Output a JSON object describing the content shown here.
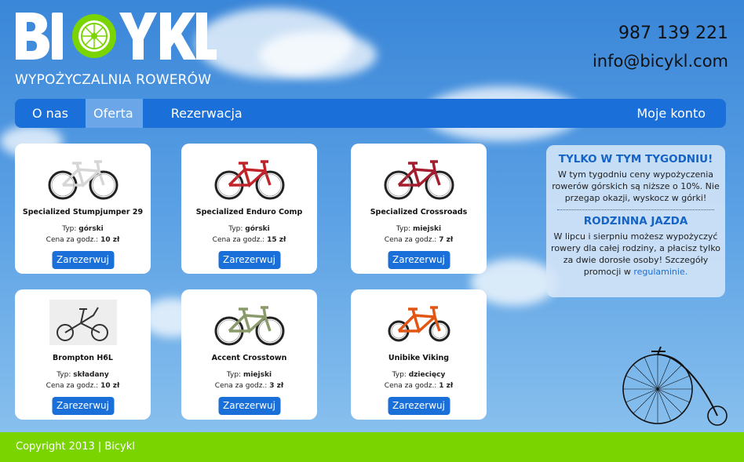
{
  "brand": {
    "name": "BICYKL",
    "tagline": "WYPOŻYCZALNIA ROWERÓW"
  },
  "contact": {
    "phone": "987 139 221",
    "email": "info@bicykl.com"
  },
  "nav": {
    "items": [
      {
        "label": "O nas"
      },
      {
        "label": "Oferta"
      },
      {
        "label": "Rezerwacja"
      }
    ],
    "account": "Moje konto"
  },
  "labels": {
    "type": "Typ:",
    "price": "Cena za godz.:",
    "reserve": "Zarezerwuj"
  },
  "bikes": [
    {
      "name": "Specialized Stumpjumper 29",
      "type": "górski",
      "price": "10 zł",
      "color": "#d6d6d6"
    },
    {
      "name": "Specialized Enduro Comp",
      "type": "górski",
      "price": "15 zł",
      "color": "#c0232a"
    },
    {
      "name": "Specialized Crossroads",
      "type": "miejski",
      "price": "7 zł",
      "color": "#a41d2e"
    },
    {
      "name": "Brompton H6L",
      "type": "składany",
      "price": "10 zł",
      "color": "#333333"
    },
    {
      "name": "Accent Crosstown",
      "type": "miejski",
      "price": "3 zł",
      "color": "#8a9a6a"
    },
    {
      "name": "Unibike Viking",
      "type": "dziecięcy",
      "price": "1 zł",
      "color": "#e25512"
    }
  ],
  "promo": {
    "title1": "TYLKO W TYM TYGODNIU!",
    "text1": "W tym tygodniu ceny wypożyczenia rowerów górskich są niższe o 10%. Nie przegap okazji, wyskocz w górki!",
    "title2": "RODZINNA JAZDA",
    "text2": "W lipcu i sierpniu możesz wypożyczyć rowery dla całej rodziny, a płacisz tylko za dwie dorosłe osoby! Szczegóły promocji w",
    "link": "regulaminie."
  },
  "footer": {
    "text": "Copyright 2013  |  Bicykl"
  },
  "colors": {
    "accent": "#1a6fd8",
    "footer": "#79d400",
    "promoTitle": "#1563c4"
  }
}
